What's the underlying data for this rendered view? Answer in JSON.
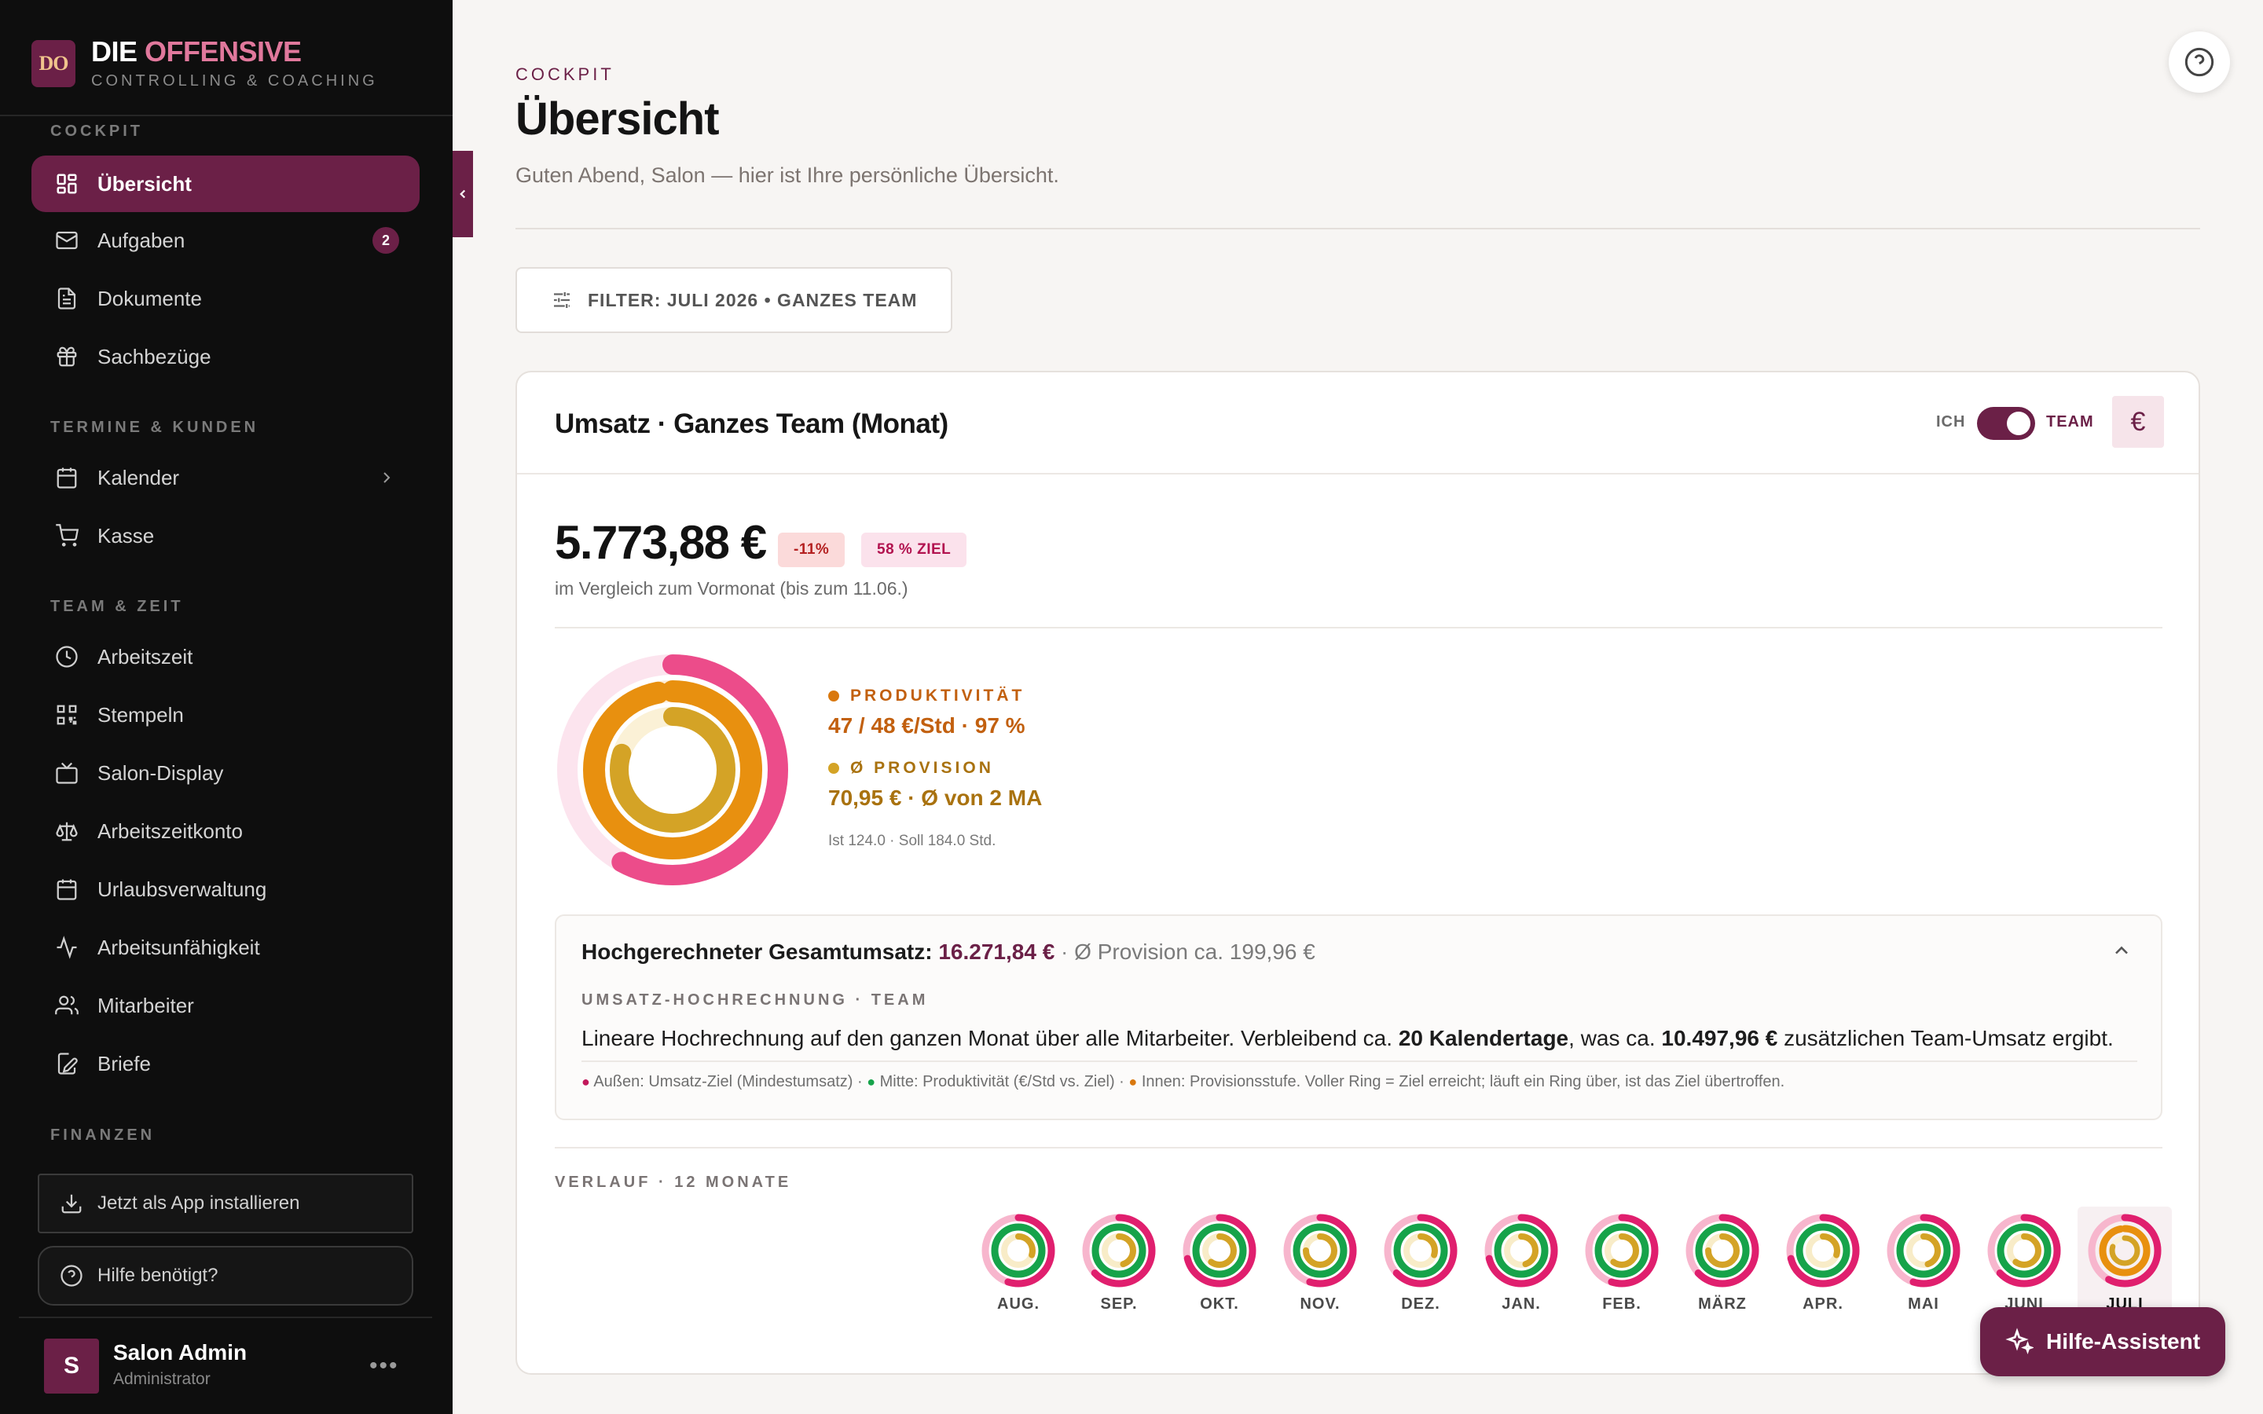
{
  "brand": {
    "logo": "DO",
    "title_main": "DIE",
    "title_accent": "OFFENSIVE",
    "subtitle": "CONTROLLING & COACHING",
    "accent_color": "#e0789c"
  },
  "sidebar": {
    "sections": {
      "cockpit": "COCKPIT",
      "termine": "TERMINE & KUNDEN",
      "team": "TEAM & ZEIT",
      "finanzen": "FINANZEN"
    },
    "items": [
      {
        "label": "Übersicht",
        "icon": "grid-icon",
        "active": true
      },
      {
        "label": "Aufgaben",
        "icon": "mail-icon",
        "badge": "2"
      },
      {
        "label": "Dokumente",
        "icon": "document-icon"
      },
      {
        "label": "Sachbezüge",
        "icon": "gift-icon"
      },
      {
        "label": "Kalender",
        "icon": "calendar-icon"
      },
      {
        "label": "Kasse",
        "icon": "cart-icon"
      },
      {
        "label": "Arbeitszeit",
        "icon": "clock-icon"
      },
      {
        "label": "Stempeln",
        "icon": "qr-icon"
      },
      {
        "label": "Salon-Display",
        "icon": "tv-icon"
      },
      {
        "label": "Arbeitszeitkonto",
        "icon": "scale-icon"
      },
      {
        "label": "Urlaubsverwaltung",
        "icon": "calendar-icon"
      },
      {
        "label": "Arbeitsunfähigkeit",
        "icon": "activity-icon"
      },
      {
        "label": "Mitarbeiter",
        "icon": "users-icon"
      },
      {
        "label": "Briefe",
        "icon": "edit-icon"
      }
    ],
    "install_label": "Jetzt als App installieren",
    "help_label": "Hilfe benötigt?",
    "user": {
      "initial": "S",
      "name": "Salon Admin",
      "role": "Administrator"
    }
  },
  "header": {
    "eyebrow": "COCKPIT",
    "title": "Übersicht",
    "subtitle": "Guten Abend, Salon — hier ist Ihre persönliche Übersicht."
  },
  "filter": {
    "label": "FILTER: JULI 2026 • GANZES TEAM"
  },
  "card": {
    "title": "Umsatz · Ganzes Team (Monat)",
    "toggle_left": "ICH",
    "toggle_right": "TEAM",
    "currency_symbol": "€",
    "value": "5.773,88 €",
    "change_badge": "-11%",
    "goal_badge": "58 % ZIEL",
    "compare_text": "im Vergleich zum Vormonat (bis zum 11.06.)",
    "rings": {
      "outer_goal": 0.58,
      "middle_productivity": 0.97,
      "inner_provision": 0.8
    },
    "stats": [
      {
        "label": "PRODUKTIVITÄT",
        "value": "47 / 48 €/Std · 97 %",
        "color": "#c2600f"
      },
      {
        "label": "Ø PROVISION",
        "value": "70,95 € · Ø von 2 MA",
        "color": "#a9720f"
      }
    ],
    "hours_note": "Ist 124.0 · Soll 184.0 Std.",
    "projection": {
      "title_prefix": "Hochgerechneter Gesamtumsatz:",
      "total": "16.271,84 €",
      "sep": " · ",
      "provision": "Ø Provision ca. 199,96 €",
      "label": "UMSATZ-HOCHRECHNUNG · TEAM",
      "text_1": "Lineare Hochrechnung auf den ganzen Monat über alle Mitarbeiter. Verbleibend ca. ",
      "days": "20 Kalendertage",
      "text_2": ", was ca. ",
      "remaining": "10.497,96 €",
      "text_3": " zusätzlichen Team-Umsatz ergibt.",
      "legend_outer": "Außen: Umsatz-Ziel (Mindestumsatz)",
      "legend_middle": "Mitte: Produktivität (€/Std vs. Ziel)",
      "legend_inner": "Innen: Provisionsstufe. Voller Ring = Ziel erreicht; läuft ein Ring über, ist das Ziel übertroffen."
    },
    "history_label": "VERLAUF · 12 MONATE",
    "months": [
      "AUG.",
      "SEP.",
      "OKT.",
      "NOV.",
      "DEZ.",
      "JAN.",
      "FEB.",
      "MÄRZ",
      "APR.",
      "MAI",
      "JUNI",
      "JULI"
    ]
  },
  "assistant_label": "Hilfe-Assistent",
  "colors": {
    "brand": "#6b2047",
    "ring_outer": "#e8417f",
    "ring_middle": "#e8900f",
    "ring_inner": "#d4a326",
    "ring_green": "#16a34a"
  }
}
